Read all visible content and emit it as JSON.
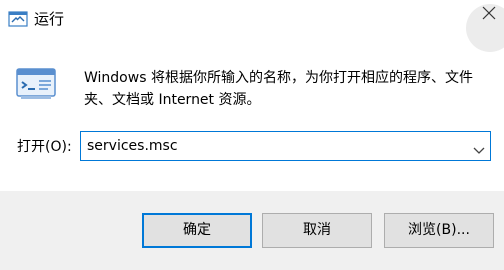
{
  "window": {
    "title": "运行",
    "close_glyph": "×",
    "icons": {
      "title": "run-icon",
      "close": "close-icon",
      "app": "run-dialog-icon",
      "dropdown": "chevron-down-icon"
    }
  },
  "main": {
    "description": "Windows 将根据你所输入的名称，为你打开相应的程序、文件夹、文档或 Internet 资源。",
    "open_label": "打开(O):",
    "open_value": "services.msc"
  },
  "footer": {
    "ok_label": "确定",
    "cancel_label": "取消",
    "browse_label": "浏览(B)..."
  },
  "colors": {
    "accent": "#0078d7",
    "footer_bg": "#f0f0f0",
    "button_bg": "#e1e1e1"
  }
}
